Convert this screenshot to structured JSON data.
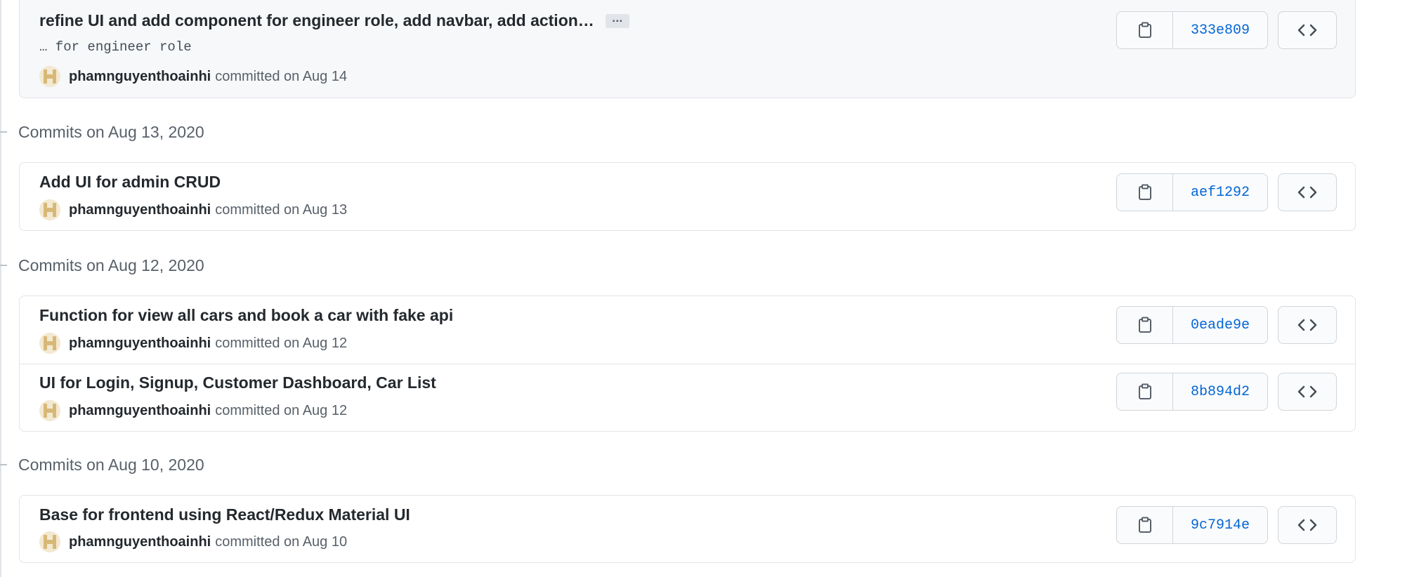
{
  "commits_groups": [
    {
      "heading": "",
      "commits": [
        {
          "message": "refine UI and add component for engineer role, add navbar, add action…",
          "ellipsis": "…",
          "description": "… for engineer role",
          "author": "phamnguyenthoainhi",
          "committed_text": "committed on Aug 14",
          "sha": "333e809"
        }
      ]
    },
    {
      "heading": "Commits on Aug 13, 2020",
      "commits": [
        {
          "message": "Add UI for admin CRUD",
          "author": "phamnguyenthoainhi",
          "committed_text": "committed on Aug 13",
          "sha": "aef1292"
        }
      ]
    },
    {
      "heading": "Commits on Aug 12, 2020",
      "commits": [
        {
          "message": "Function for view all cars and book a car with fake api",
          "author": "phamnguyenthoainhi",
          "committed_text": "committed on Aug 12",
          "sha": "0eade9e"
        },
        {
          "message": "UI for Login, Signup, Customer Dashboard, Car List",
          "author": "phamnguyenthoainhi",
          "committed_text": "committed on Aug 12",
          "sha": "8b894d2"
        }
      ]
    },
    {
      "heading": "Commits on Aug 10, 2020",
      "commits": [
        {
          "message": "Base for frontend using React/Redux Material UI",
          "author": "phamnguyenthoainhi",
          "committed_text": "committed on Aug 10",
          "sha": "9c7914e"
        }
      ]
    }
  ],
  "icons": {
    "copy": "clipboard-icon",
    "browse": "code-icon",
    "avatar": "identicon-avatar"
  },
  "colors": {
    "sha_link": "#0366d6",
    "highlight_bg": "#f6f8fa",
    "border": "#e1e4e8"
  }
}
